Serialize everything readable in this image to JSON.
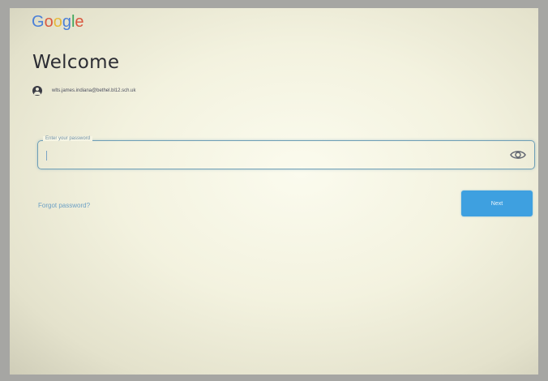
{
  "logo": {
    "letters": [
      "G",
      "o",
      "o",
      "g",
      "l",
      "e"
    ],
    "colors": [
      "#4a7fd8",
      "#d9583f",
      "#e6b93a",
      "#4a7fd8",
      "#3ea65a",
      "#d9583f"
    ]
  },
  "page": {
    "title": "Welcome"
  },
  "account": {
    "icon": "account-circle-icon",
    "email": "wlts.james.indiana@bethel.bl12.sch.uk"
  },
  "password_field": {
    "label": "Enter your password",
    "value": "",
    "eye_icon": "show-password-eye-icon"
  },
  "actions": {
    "forgot_label": "Forgot password?",
    "next_label": "Next"
  },
  "colors": {
    "accent": "#3ea0e0",
    "link": "#6b9fc4",
    "field_border": "#6f9fb6"
  }
}
